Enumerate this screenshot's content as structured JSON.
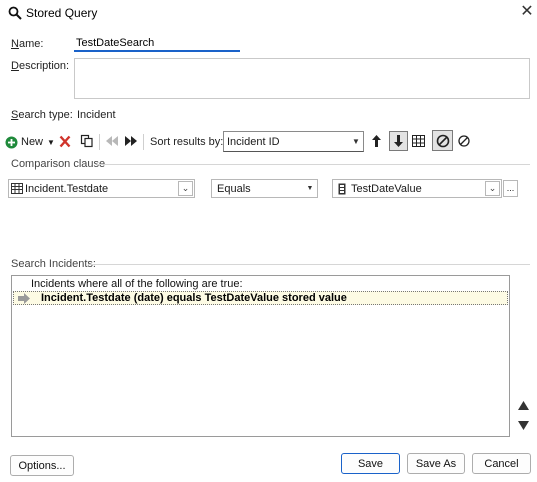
{
  "window": {
    "title": "Stored Query",
    "close_glyph": "✕"
  },
  "form": {
    "name_label": "Name:",
    "name_value": "TestDateSearch",
    "description_label": "Description:",
    "description_value": "",
    "search_type_label": "Search type:",
    "search_type_value": "Incident"
  },
  "toolbar": {
    "new_label": "New",
    "sort_label": "Sort results by:",
    "sort_value": "Incident ID"
  },
  "comparison": {
    "group_label": "Comparison clause",
    "field_value": "Incident.Testdate",
    "operator_value": "Equals",
    "value_value": "TestDateValue",
    "ellipsis": "..."
  },
  "results": {
    "group_label": "Search Incidents:",
    "root_text": "Incidents where all of the following are true:",
    "rows": [
      {
        "text": "Incident.Testdate (date) equals TestDateValue stored value"
      }
    ]
  },
  "buttons": {
    "options": "Options...",
    "save": "Save",
    "save_as": "Save As",
    "cancel": "Cancel"
  },
  "icons": {
    "window": "magnifier-icon",
    "new": "plus-circle-icon",
    "delete": "red-x-icon",
    "copy": "copy-icon",
    "prev": "step-back-icon",
    "next": "step-forward-icon",
    "sort_asc": "arrow-up-icon",
    "sort_desc": "arrow-down-icon",
    "grid": "table-icon",
    "match_all": "circle-slash-icon",
    "match_any": "circle-slash-outline-icon",
    "field": "table-field-icon",
    "value": "stored-value-icon",
    "row": "row-diamond-icon",
    "move_up": "triangle-up-icon",
    "move_down": "triangle-down-icon"
  },
  "colors": {
    "accent": "#1a62c9",
    "new_green": "#1f8a3b",
    "delete_red": "#d0342c",
    "row_highlight": "#fdfbe4"
  }
}
